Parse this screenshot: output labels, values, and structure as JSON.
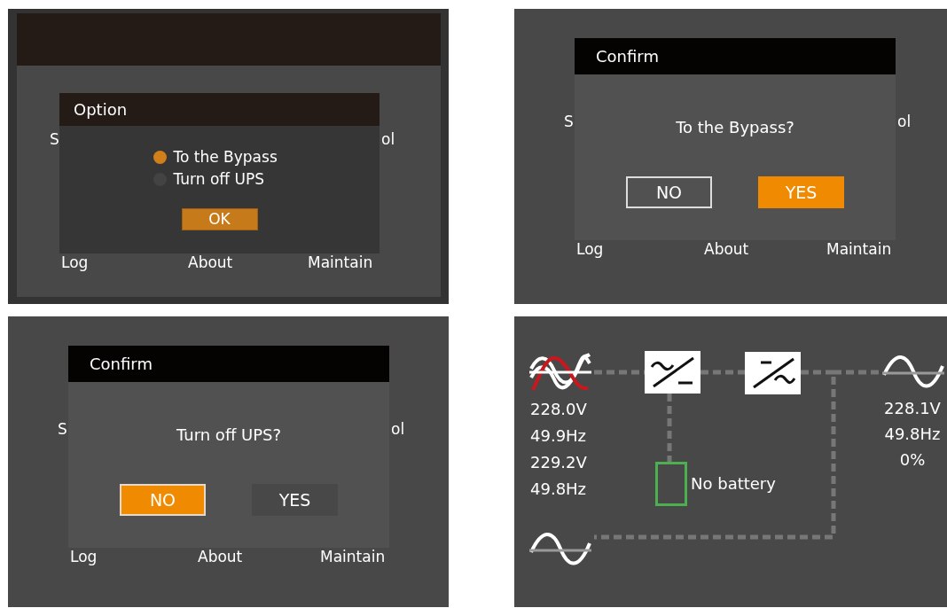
{
  "panels": [
    {
      "kind": "option",
      "background_labels": [
        "S",
        "ol"
      ],
      "menu": [
        "Log",
        "About",
        "Maintain"
      ],
      "dialog": {
        "title": "Option",
        "options": [
          {
            "label": "To the Bypass",
            "selected": true
          },
          {
            "label": "Turn off UPS",
            "selected": false
          }
        ],
        "buttons": [
          {
            "label": "OK",
            "kind": "filled",
            "selected": true
          }
        ]
      }
    },
    {
      "kind": "confirm",
      "background_labels": [
        "S",
        "ol"
      ],
      "menu": [
        "Log",
        "About",
        "Maintain"
      ],
      "dialog": {
        "title": "Confirm",
        "message": "To the Bypass?",
        "buttons": [
          {
            "label": "NO",
            "kind": "outlined",
            "selected": false
          },
          {
            "label": "YES",
            "kind": "filled",
            "selected": true
          }
        ]
      }
    },
    {
      "kind": "confirm",
      "background_labels": [
        "S",
        "ol"
      ],
      "menu": [
        "Log",
        "About",
        "Maintain"
      ],
      "dialog": {
        "title": "Confirm",
        "message": "Turn off UPS?",
        "buttons": [
          {
            "label": "NO",
            "kind": "filled",
            "selected": true
          },
          {
            "label": "YES",
            "kind": "filled",
            "selected": false
          }
        ]
      }
    },
    {
      "kind": "flow",
      "input": {
        "readings": [
          "228.0V",
          "49.9Hz",
          "229.2V",
          "49.8Hz"
        ]
      },
      "battery": {
        "label": "No battery"
      },
      "output": {
        "readings": [
          "228.1V",
          "49.8Hz",
          "0%"
        ]
      }
    }
  ]
}
